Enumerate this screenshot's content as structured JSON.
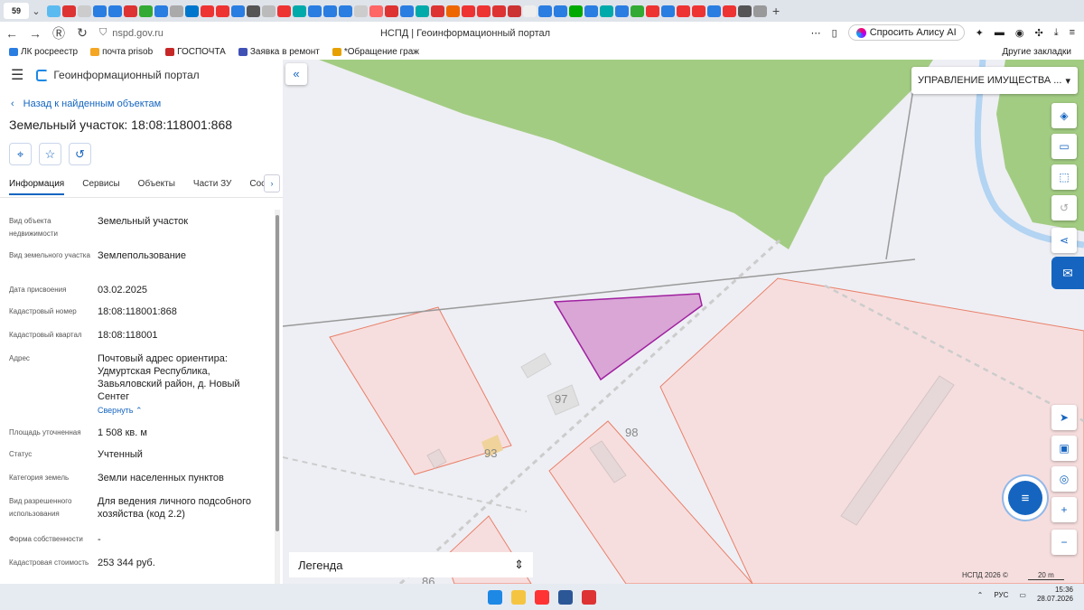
{
  "browser": {
    "tab_count": "59",
    "page_title": "НСПД | Геоинформационный портал",
    "url": "nspd.gov.ru",
    "alice_button": "Спросить Алису AI",
    "bookmarks": [
      "ЛК росреестр",
      "почта prisob",
      "ГОСПОЧТА",
      "Заявка в ремонт",
      "*Обращение граж"
    ],
    "other_bookmarks": "Другие закладки"
  },
  "app": {
    "title": "Геоинформационный портал",
    "back_link": "Назад к найденным объектам",
    "object_title": "Земельный участок: 18:08:118001:868",
    "tabs": [
      "Информация",
      "Сервисы",
      "Объекты",
      "Части ЗУ",
      "Состав"
    ]
  },
  "properties": [
    {
      "label": "Вид объекта недвижимости",
      "value": "Земельный участок"
    },
    {
      "label": "Вид земельного участка",
      "value": "Землепользование"
    },
    {
      "label": "Дата присвоения",
      "value": "03.02.2025"
    },
    {
      "label": "Кадастровый номер",
      "value": "18:08:118001:868"
    },
    {
      "label": "Кадастровый квартал",
      "value": "18:08:118001"
    },
    {
      "label": "Адрес",
      "value": "Почтовый адрес ориентира: Удмуртская Республика, Завьяловский район, д. Новый Сентег",
      "link": "Свернуть"
    },
    {
      "label": "Площадь уточненная",
      "value": "1 508 кв. м"
    },
    {
      "label": "Статус",
      "value": "Учтенный"
    },
    {
      "label": "Категория земель",
      "value": "Земли населенных пунктов"
    },
    {
      "label": "Вид разрешенного использования",
      "value": "Для ведения личного подсобного хозяйства (код 2.2)"
    },
    {
      "label": "Форма собственности",
      "value": "-"
    },
    {
      "label": "Кадастровая стоимость",
      "value": "253 344 руб."
    }
  ],
  "map": {
    "layer_select": "УПРАВЛЕНИЕ ИМУЩЕСТВА ...",
    "legend": "Легенда",
    "copyright": "НСПД 2026 ©",
    "scale": "20 m",
    "house_numbers": [
      "97",
      "98",
      "93",
      "86"
    ],
    "colors": {
      "forest": "#a3cc83",
      "water": "#b3d4f2",
      "parcel_fill": "#f7dede",
      "parcel_stroke": "#e8806a",
      "selected_fill": "#d9a6d6",
      "selected_stroke": "#a020a0"
    }
  },
  "taskbar": {
    "lang": "РУС",
    "time": "15:36",
    "date": "28.07.2026"
  }
}
